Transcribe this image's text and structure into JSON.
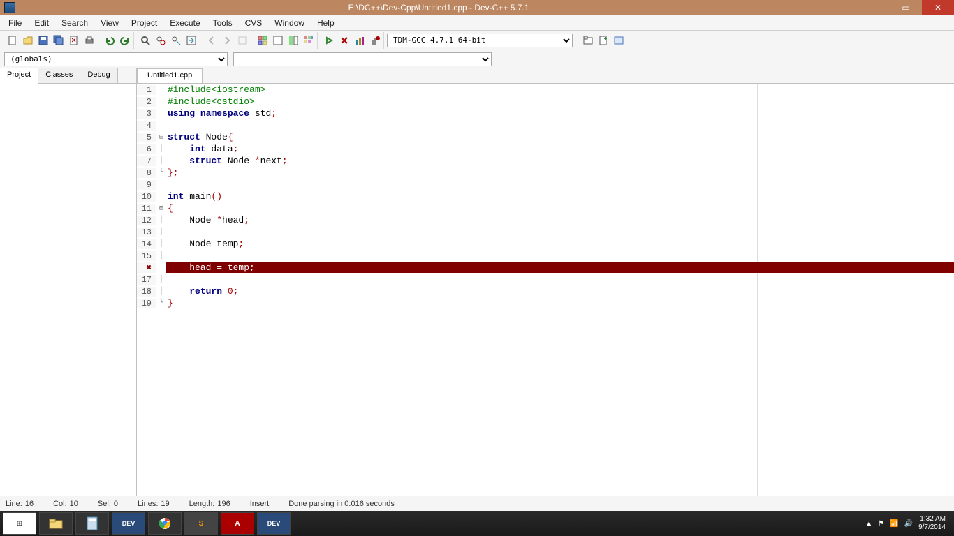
{
  "title": "E:\\DC++\\Dev-Cpp\\Untitled1.cpp - Dev-C++ 5.7.1",
  "menu": [
    "File",
    "Edit",
    "Search",
    "View",
    "Project",
    "Execute",
    "Tools",
    "CVS",
    "Window",
    "Help"
  ],
  "compiler": "TDM-GCC 4.7.1 64-bit",
  "scope": "(globals)",
  "side_tabs": [
    "Project",
    "Classes",
    "Debug"
  ],
  "file_tab": "Untitled1.cpp",
  "code": [
    {
      "n": "1",
      "fold": "",
      "html": "<span class='pp'>#include&lt;iostream&gt;</span>"
    },
    {
      "n": "2",
      "fold": "",
      "html": "<span class='pp'>#include&lt;cstdio&gt;</span>"
    },
    {
      "n": "3",
      "fold": "",
      "html": "<span class='kw'>using</span> <span class='kw'>namespace</span> std<span class='op'>;</span>"
    },
    {
      "n": "4",
      "fold": "",
      "html": ""
    },
    {
      "n": "5",
      "fold": "⊟",
      "html": "<span class='kw'>struct</span> Node<span class='br'>{</span>"
    },
    {
      "n": "6",
      "fold": "│",
      "html": "    <span class='kw'>int</span> data<span class='op'>;</span>"
    },
    {
      "n": "7",
      "fold": "│",
      "html": "    <span class='kw'>struct</span> Node <span class='op'>*</span>next<span class='op'>;</span>"
    },
    {
      "n": "8",
      "fold": "└",
      "html": "<span class='br'>};</span>"
    },
    {
      "n": "9",
      "fold": "",
      "html": ""
    },
    {
      "n": "10",
      "fold": "",
      "html": "<span class='kw'>int</span> main<span class='br'>()</span>"
    },
    {
      "n": "11",
      "fold": "⊟",
      "html": "<span class='br'>{</span>"
    },
    {
      "n": "12",
      "fold": "│",
      "html": "    Node <span class='op'>*</span>head<span class='op'>;</span>"
    },
    {
      "n": "13",
      "fold": "│",
      "html": ""
    },
    {
      "n": "14",
      "fold": "│",
      "html": "    Node temp<span class='op'>;</span>"
    },
    {
      "n": "15",
      "fold": "│",
      "html": ""
    },
    {
      "n": "16",
      "fold": "",
      "html": "    head = temp;",
      "error": true,
      "gut": "✖"
    },
    {
      "n": "17",
      "fold": "│",
      "html": ""
    },
    {
      "n": "18",
      "fold": "│",
      "html": "    <span class='kw'>return</span> <span class='num'>0</span><span class='op'>;</span>"
    },
    {
      "n": "19",
      "fold": "└",
      "html": "<span class='br'>}</span>"
    }
  ],
  "status": {
    "line_lbl": "Line:",
    "line": "16",
    "col_lbl": "Col:",
    "col": "10",
    "sel_lbl": "Sel:",
    "sel": "0",
    "lines_lbl": "Lines:",
    "lines": "19",
    "length_lbl": "Length:",
    "length": "196",
    "mode": "Insert",
    "parse": "Done parsing in 0.016 seconds"
  },
  "clock": {
    "time": "1:32 AM",
    "date": "9/7/2014"
  }
}
